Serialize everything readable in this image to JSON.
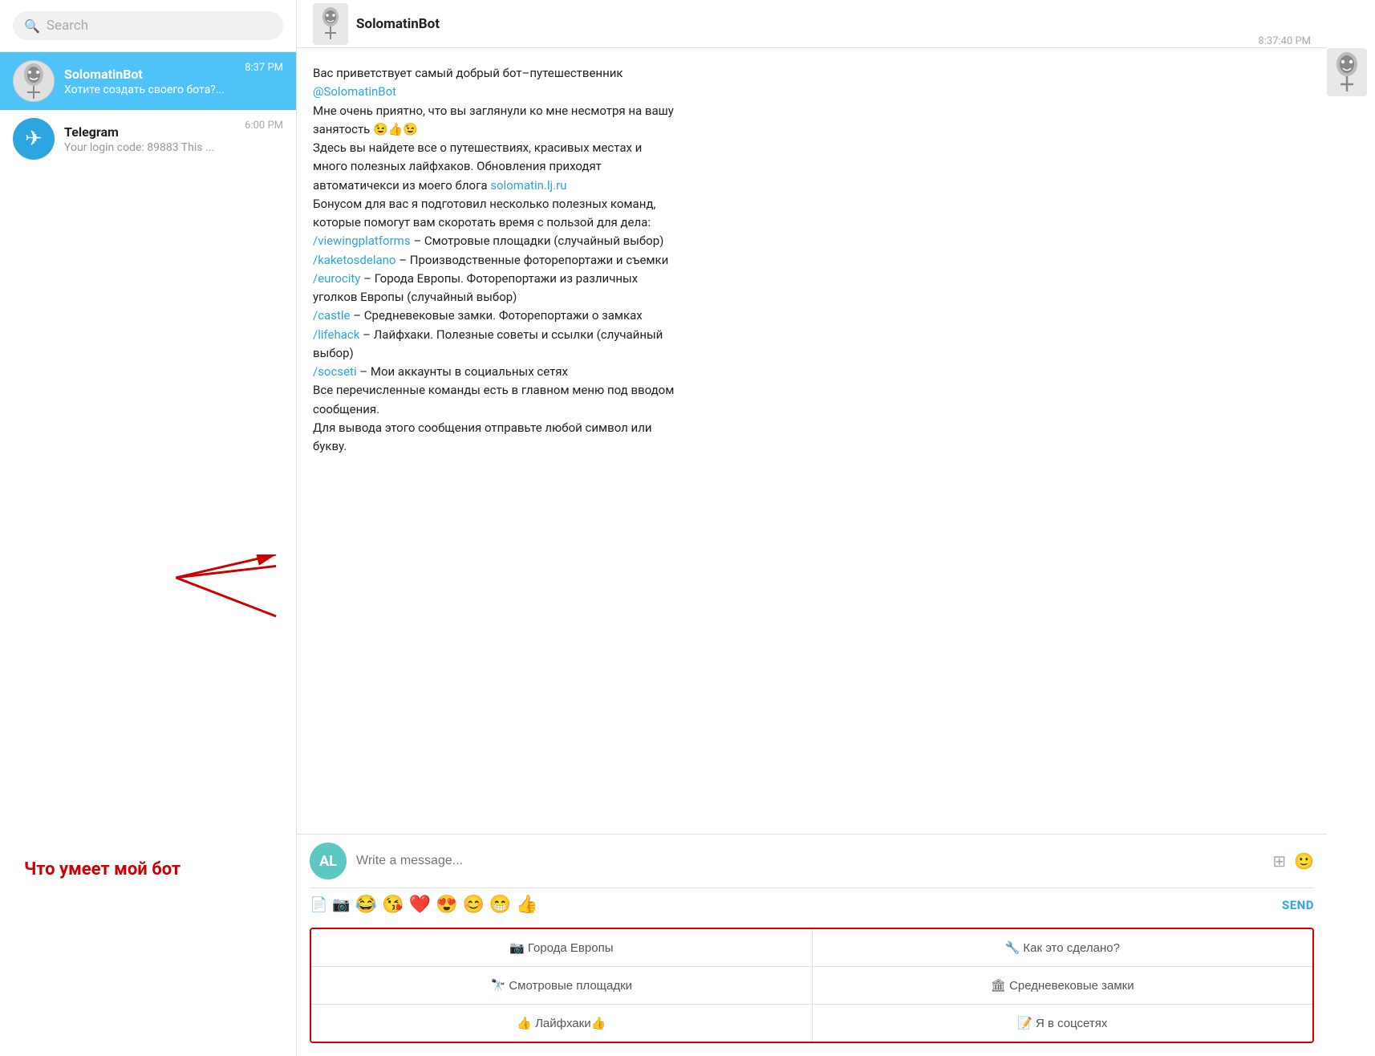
{
  "sidebar": {
    "search_placeholder": "Search",
    "chats": [
      {
        "id": "solomatin",
        "name": "SolomatinBot",
        "preview": "Хотите создать своего бота?...",
        "time": "8:37 PM",
        "active": true,
        "avatar_type": "bot"
      },
      {
        "id": "telegram",
        "name": "Telegram",
        "preview": "Your login code: 89883 This ...",
        "time": "6:00 PM",
        "active": false,
        "avatar_type": "telegram"
      }
    ]
  },
  "header": {
    "bot_name": "SolomatinBot",
    "time": "8:37:40 PM"
  },
  "message": {
    "line1": "Вас приветствует самый добрый бот–путешественник",
    "line1_link": "@SolomatinBot",
    "line2": "Мне очень приятно, что вы заглянули ко мне несмотря на вашу",
    "line2b": "занятость 😉👍😉",
    "line3": "Здесь вы найдете все о путешествиях, красивых местах и",
    "line3b": "много полезных лайфхаков. Обновления приходят",
    "line3c": "автоматичекси из моего блога",
    "line3c_link": "solomatin.lj.ru",
    "line4": "Бонусом для вас я подготовил несколько полезных команд,",
    "line4b": "которые помогут вам скоротать время с пользой для дела:",
    "cmd1": "/viewingplatforms",
    "cmd1_desc": "– Смотровые площадки (случайный выбор)",
    "cmd2": "/kaketosdelano",
    "cmd2_desc": "– Производственные фоторепортажи и съемки",
    "cmd3": "/eurocity",
    "cmd3_desc": "– Города Европы. Фоторепортажи из различных",
    "cmd3_desc2": "уголков Европы (случайный выбор)",
    "cmd4": "/castle",
    "cmd4_desc": "– Средневековые замки. Фоторепортажи о замках",
    "cmd5": "/lifehack",
    "cmd5_desc": "– Лайфхаки. Полезные советы и ссылки (случайный",
    "cmd5_desc2": "выбор)",
    "cmd6": "/socseti",
    "cmd6_desc": "– Мои аккаунты в социальных сетях",
    "footer1": "Все перечисленные команды есть в главном меню под вводом",
    "footer1b": "сообщения.",
    "footer2": "Для вывода этого сообщения отправьте любой символ или",
    "footer2b": "букву."
  },
  "input": {
    "placeholder": "Write a message...",
    "user_initials": "AL",
    "send_label": "SEND"
  },
  "emojis": [
    "😂",
    "😘",
    "❤️",
    "😍",
    "😊",
    "😁",
    "👍"
  ],
  "keyboard": {
    "buttons": [
      {
        "label": "📷 Города Европы"
      },
      {
        "label": "🔧 Как это сделано?"
      },
      {
        "label": "🔭 Смотровые площадки"
      },
      {
        "label": "🏛 Средневековые замки"
      },
      {
        "label": "👍 Лайфхаки👍"
      },
      {
        "label": "📝 Я в соцсетях"
      }
    ]
  },
  "annotation": {
    "label": "Что умеет мой бот"
  }
}
